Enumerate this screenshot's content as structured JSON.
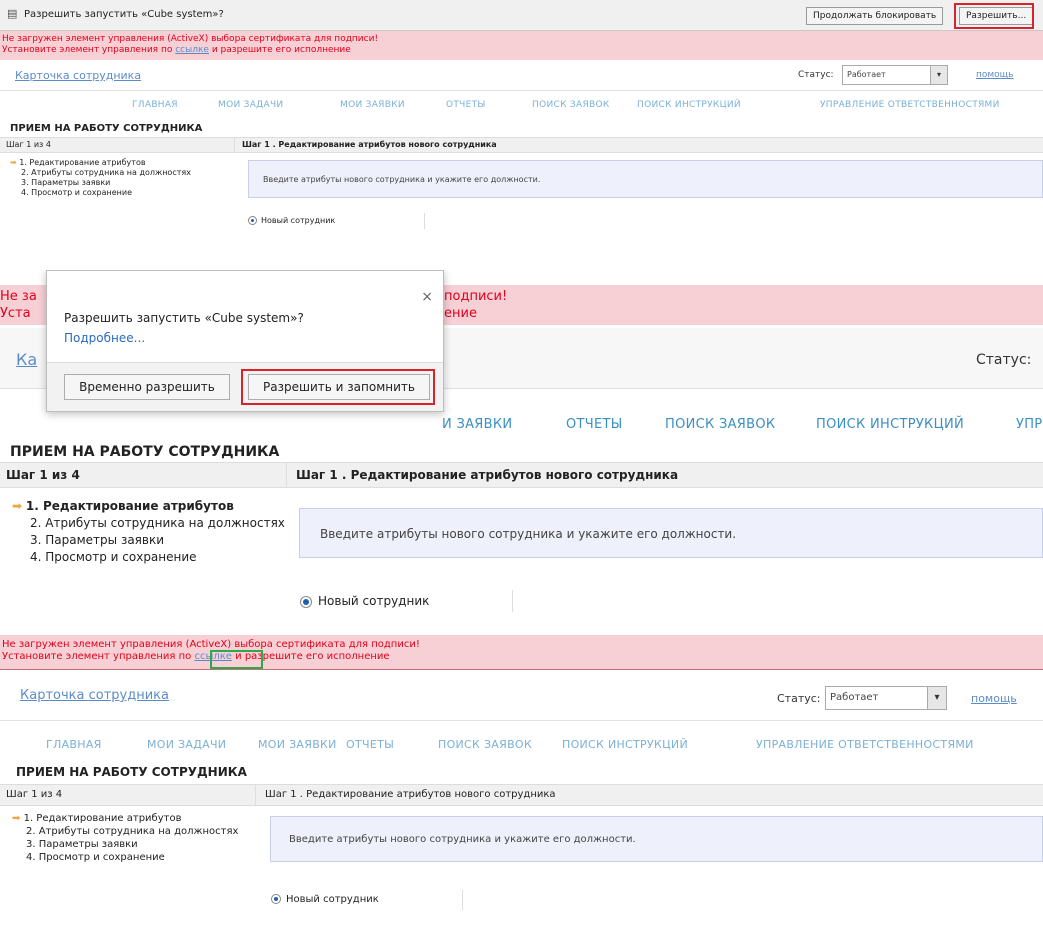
{
  "infobar": {
    "text": "Разрешить запустить «Cube system»?",
    "continue_blocking": "Продолжать блокировать",
    "allow": "Разрешить..."
  },
  "warning": {
    "line1": "Не загружен элемент управления (ActiveX) выбора сертификата для подписи!",
    "line2_before": "Установите элемент управления по",
    "line2_link": "ссылке",
    "line2_after": "и разрешите его исполнение"
  },
  "dialog": {
    "question": "Разрешить запустить «Cube system»?",
    "more_link": "Подробнее...",
    "close": "×",
    "allow_temp": "Временно разрешить",
    "allow_remember": "Разрешить и запомнить"
  },
  "header": {
    "card_title": "Карточка сотрудника",
    "status_label": "Статус:",
    "status_value": "Работает",
    "help": "помощь"
  },
  "nav": [
    "ГЛАВНАЯ",
    "МОИ ЗАДАЧИ",
    "МОИ ЗАЯВКИ",
    "ОТЧЕТЫ",
    "ПОИСК ЗАЯВОК",
    "ПОИСК ИНСТРУКЦИЙ",
    "УПРАВЛЕНИЕ ОТВЕТСТВЕННОСТЯМИ"
  ],
  "page": {
    "title": "ПРИЕМ НА РАБОТУ СОТРУДНИКА",
    "step_counter": "Шаг 1 из 4",
    "step_heading": "Шаг 1 . Редактирование атрибутов нового сотрудника",
    "steps": [
      "1. Редактирование атрибутов",
      "2. Атрибуты сотрудника на должностях",
      "3. Параметры заявки",
      "4. Просмотр и сохранение"
    ],
    "info_text": "Введите атрибуты нового сотрудника и укажите его должности.",
    "radio_label": "Новый сотрудник",
    "arrow_glyph": "➡"
  },
  "partial": {
    "warn_left_1": "Не за",
    "warn_left_2": "Уста",
    "warn_right_1": "подписи!",
    "warn_right_2": "ение",
    "card_left": "Ка",
    "status": "Статус:",
    "nav_mine": "И ЗАЯВКИ",
    "nav_reports": "ОТЧЕТЫ",
    "nav_search": "ПОИСК ЗАЯВОК",
    "nav_instr": "ПОИСК ИНСТРУКЦИЙ",
    "nav_upr": "УПР"
  },
  "colors": {
    "warning_bg": "#f7d0d6",
    "warning_text": "#e2001a",
    "link": "#5b8cc9",
    "highlight_red": "#d9222a",
    "highlight_green": "#2ea84a"
  }
}
